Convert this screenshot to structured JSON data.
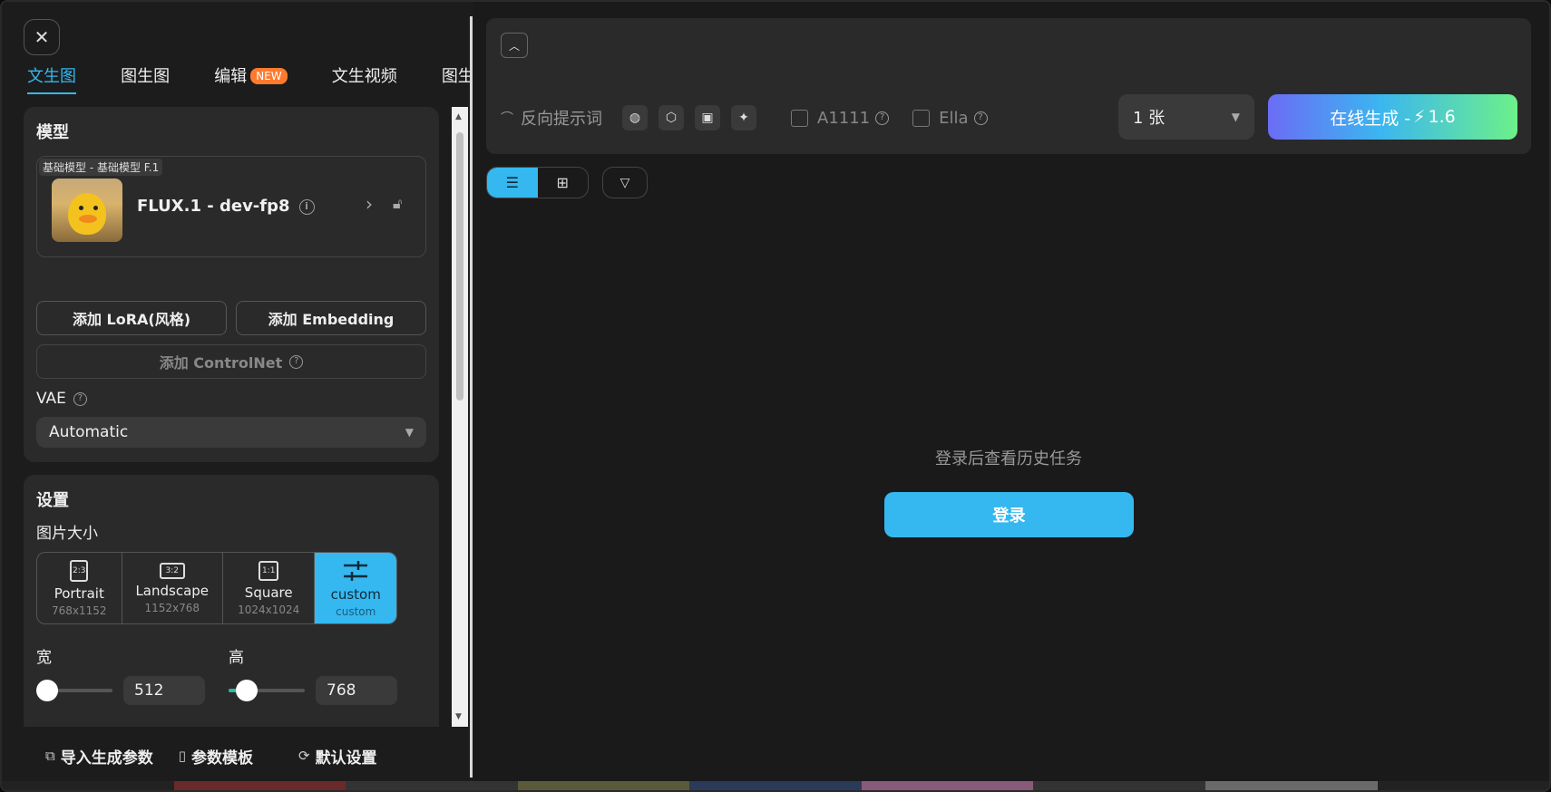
{
  "window": {
    "close_icon": "close-icon"
  },
  "tabs": [
    {
      "label": "文生图",
      "active": true
    },
    {
      "label": "图生图"
    },
    {
      "label": "编辑",
      "badge": "NEW"
    },
    {
      "label": "文生视频"
    },
    {
      "label": "图生视"
    }
  ],
  "model_section": {
    "title": "模型",
    "tag": "基础模型 - 基础模型 F.1",
    "name": "FLUX.1 - dev-fp8",
    "add_lora": "添加 LoRA(风格)",
    "add_embedding": "添加 Embedding",
    "add_controlnet": "添加 ControlNet",
    "vae_label": "VAE",
    "vae_value": "Automatic"
  },
  "settings": {
    "title": "设置",
    "image_size_label": "图片大小",
    "sizes": [
      {
        "ratio": "2:3",
        "name": "Portrait",
        "dims": "768x1152"
      },
      {
        "ratio": "3:2",
        "name": "Landscape",
        "dims": "1152x768"
      },
      {
        "ratio": "1:1",
        "name": "Square",
        "dims": "1024x1024"
      },
      {
        "ratio": "",
        "name": "custom",
        "dims": "custom",
        "active": true
      }
    ],
    "width_label": "宽",
    "width_value": "512",
    "height_label": "高",
    "height_value": "768"
  },
  "footer": {
    "import_params": "导入生成参数",
    "param_template": "参数模板",
    "default_settings": "默认设置"
  },
  "prompt": {
    "negative_prompt": "反向提示词",
    "a1111_label": "A1111",
    "ella_label": "Ella",
    "count_value": "1 张",
    "generate_label": "在线生成 - ",
    "generate_cost": "1.6"
  },
  "history": {
    "empty_message": "登录后查看历史任务",
    "login_label": "登录"
  },
  "colors": {
    "accent": "#35b8f0",
    "badge": "#ff7a2e",
    "panel": "#2a2a2a",
    "background": "#1a1a1a"
  }
}
